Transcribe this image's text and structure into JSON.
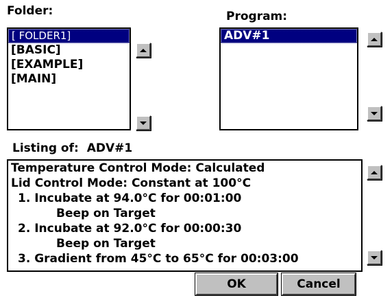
{
  "folder": {
    "label": "Folder:",
    "items": [
      "[ FOLDER1]",
      "[BASIC]",
      "[EXAMPLE]",
      "[MAIN]"
    ],
    "selected_index": 0
  },
  "program": {
    "label": "Program:",
    "items": [
      "ADV#1"
    ],
    "selected_index": 0
  },
  "listing": {
    "label_prefix": "Listing of:",
    "program_name": "ADV#1",
    "lines": [
      "Temperature Control Mode: Calculated",
      "Lid Control Mode: Constant at 100°C",
      "1. Incubate at 94.0°C for 00:01:00",
      "Beep on Target",
      "2. Incubate at 92.0°C for 00:00:30",
      "Beep on Target",
      "3. Gradient from  45°C to  65°C for 00:03:00"
    ]
  },
  "buttons": {
    "ok": "OK",
    "cancel": "Cancel"
  },
  "colors": {
    "selection": "#000080",
    "button_face": "#c0c0c0"
  }
}
